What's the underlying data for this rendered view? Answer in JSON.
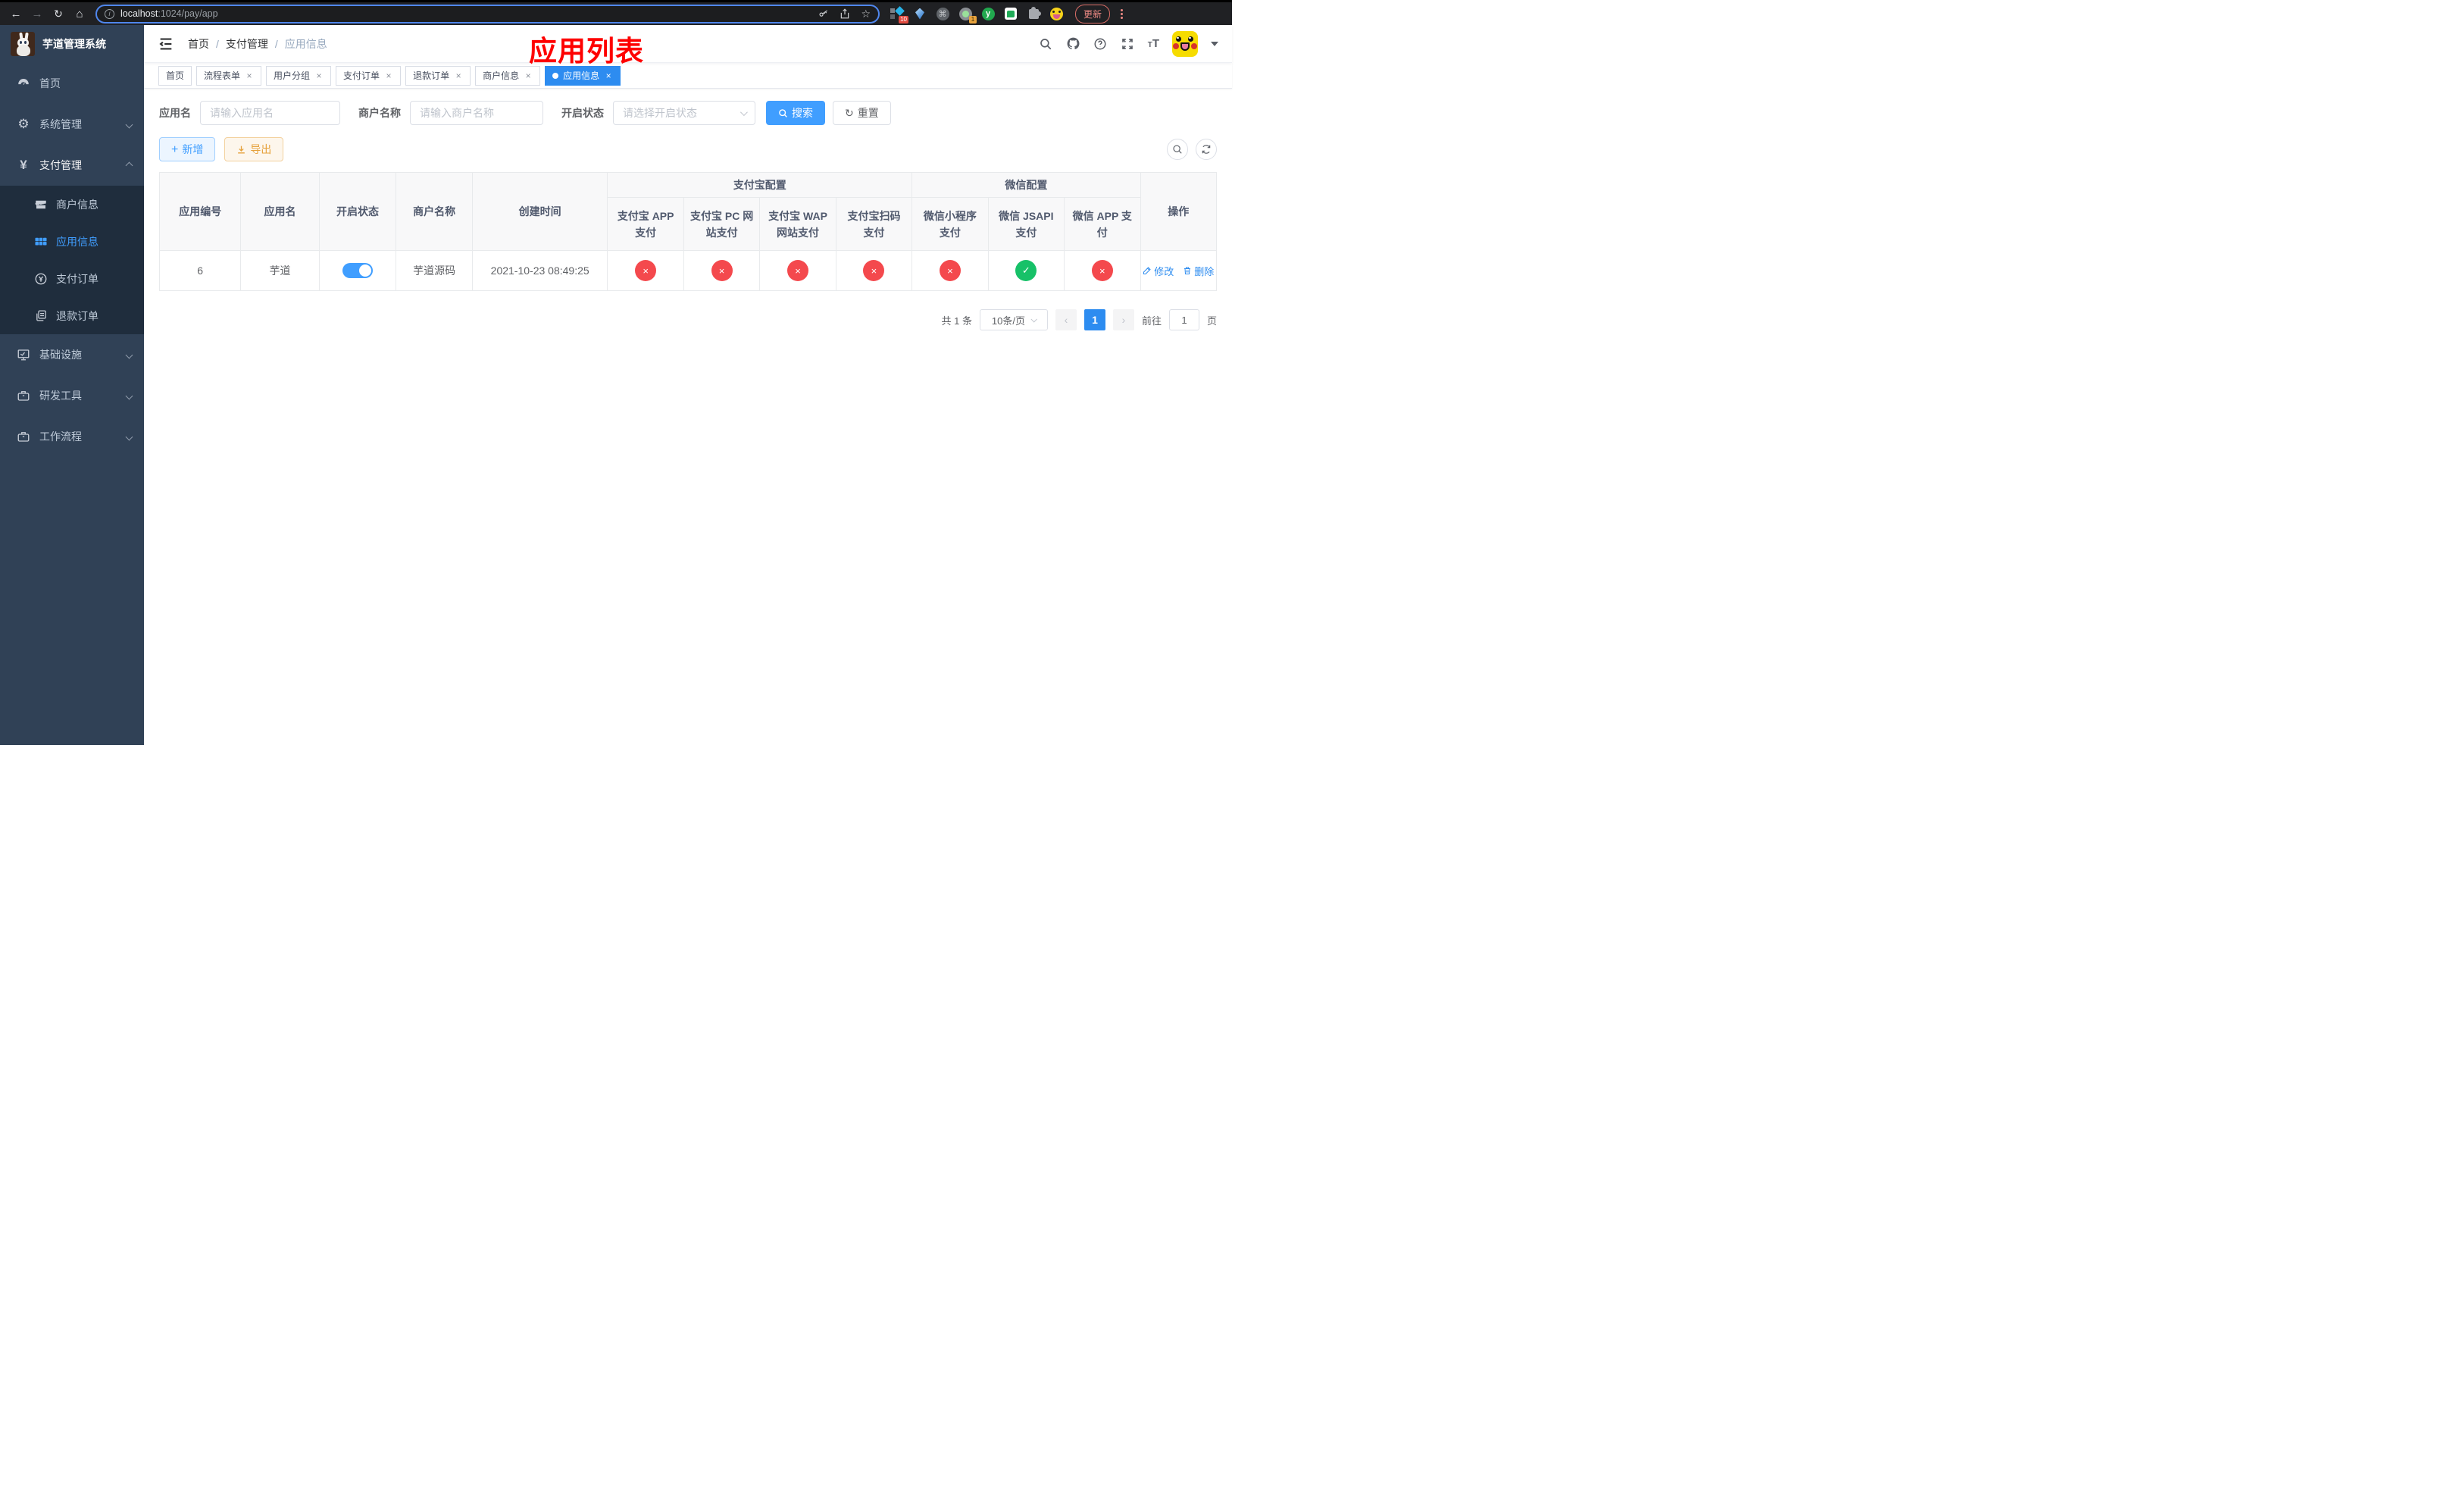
{
  "browser": {
    "url_host": "localhost",
    "url_rest": ":1024/pay/app",
    "update_label": "更新",
    "ext_badge_blue": "10",
    "ext_badge_orange": "1",
    "ext_y_label": "y"
  },
  "annotation_title": "应用列表",
  "sidebar": {
    "title": "芋道管理系统",
    "items": [
      {
        "label": "首页",
        "icon": "dashboard-icon"
      },
      {
        "label": "系统管理",
        "icon": "gear-icon"
      },
      {
        "label": "支付管理",
        "icon": "yen-icon"
      },
      {
        "label": "基础设施",
        "icon": "monitor-icon"
      },
      {
        "label": "研发工具",
        "icon": "toolbox-icon"
      },
      {
        "label": "工作流程",
        "icon": "briefcase-icon"
      }
    ],
    "submenu": [
      {
        "label": "商户信息",
        "icon": "shop-icon"
      },
      {
        "label": "应用信息",
        "icon": "grid-icon"
      },
      {
        "label": "支付订单",
        "icon": "coin-icon"
      },
      {
        "label": "退款订单",
        "icon": "document-icon"
      }
    ]
  },
  "breadcrumb": {
    "home": "首页",
    "section": "支付管理",
    "page": "应用信息"
  },
  "tabs": [
    {
      "label": "首页"
    },
    {
      "label": "流程表单"
    },
    {
      "label": "用户分组"
    },
    {
      "label": "支付订单"
    },
    {
      "label": "退款订单"
    },
    {
      "label": "商户信息"
    },
    {
      "label": "应用信息"
    }
  ],
  "filters": {
    "app_name_label": "应用名",
    "app_name_placeholder": "请输入应用名",
    "merchant_label": "商户名称",
    "merchant_placeholder": "请输入商户名称",
    "status_label": "开启状态",
    "status_placeholder": "请选择开启状态",
    "search_label": "搜索",
    "reset_label": "重置"
  },
  "toolbar": {
    "add_label": "新增",
    "export_label": "导出"
  },
  "table": {
    "headers": [
      "应用编号",
      "应用名",
      "开启状态",
      "商户名称",
      "创建时间"
    ],
    "group_alipay": "支付宝配置",
    "group_wechat": "微信配置",
    "sub_headers": [
      "支付宝 APP 支付",
      "支付宝 PC 网站支付",
      "支付宝 WAP 网站支付",
      "支付宝扫码支付",
      "微信小程序支付",
      "微信 JSAPI 支付",
      "微信 APP 支付"
    ],
    "op_header": "操作",
    "row": {
      "id": "6",
      "name": "芋道",
      "enabled": true,
      "merchant": "芋道源码",
      "created": "2021-10-23 08:49:25",
      "statuses": [
        "fail",
        "fail",
        "fail",
        "fail",
        "fail",
        "success",
        "fail"
      ],
      "edit_label": "修改",
      "delete_label": "删除"
    }
  },
  "pagination": {
    "total": "共 1 条",
    "page_size": "10条/页",
    "current_page": "1",
    "goto_label": "前往",
    "goto_value": "1",
    "page_unit": "页"
  },
  "colors": {
    "primary": "#409eff",
    "active_tab": "#2d8cf0",
    "success": "#17c168",
    "danger": "#f4494d",
    "annotation": "#fe0000"
  }
}
